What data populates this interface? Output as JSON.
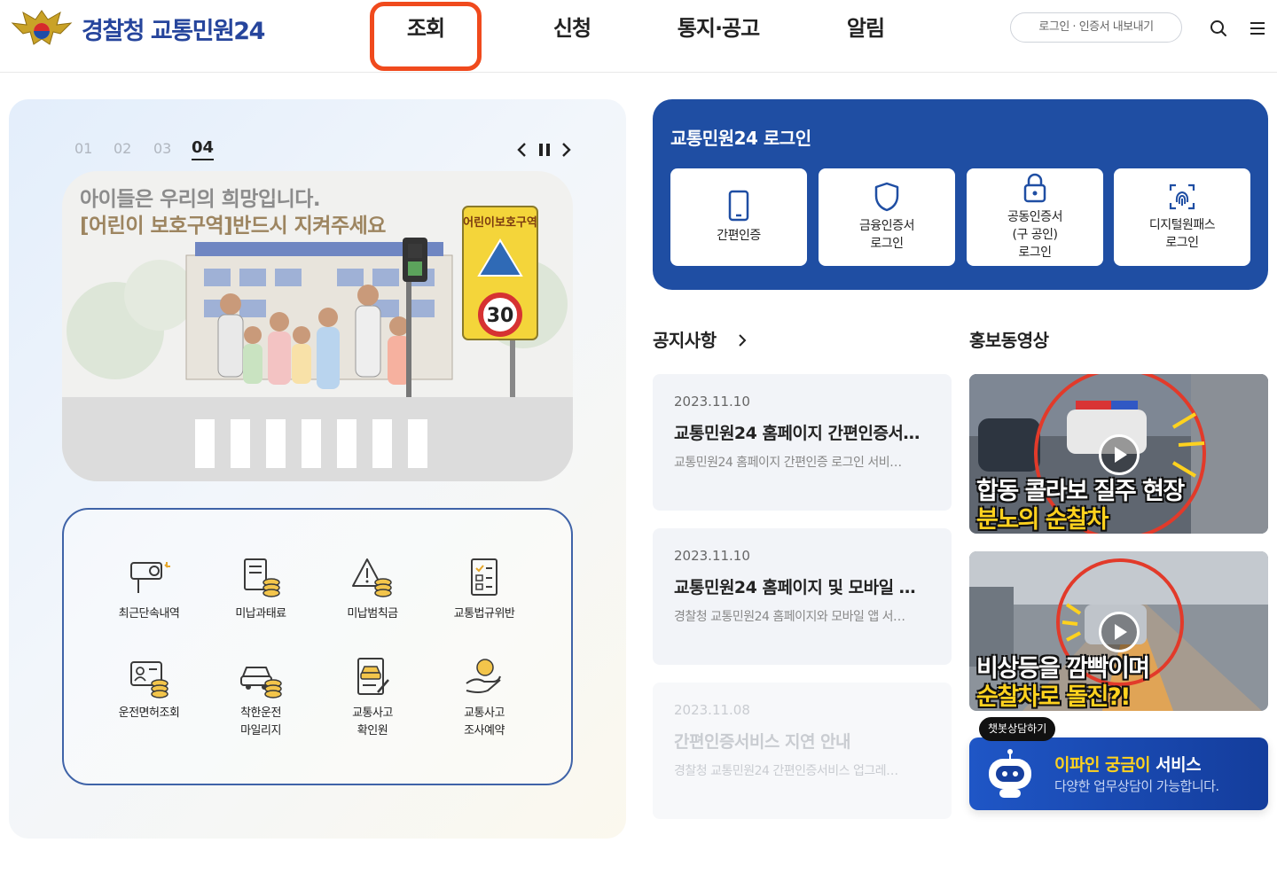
{
  "header": {
    "logo_text": "경찰청 교통민원24",
    "nav": [
      "조회",
      "신청",
      "통지·공고",
      "알림"
    ],
    "util_label": "로그인 · 인증서 내보내기",
    "colors": {
      "brand": "#26459c",
      "highlight": "#f04a1d"
    }
  },
  "slider": {
    "numbers": [
      "01",
      "02",
      "03",
      "04"
    ],
    "active": "04",
    "banner_line1": "아이들은 우리의 희망입니다.",
    "banner_line2": "[어린이 보호구역]반드시 지켜주세요",
    "sign_text": "어린이보호구역",
    "speed_limit": "30"
  },
  "quick_menu": [
    {
      "label": "최근단속내역",
      "icon": "speed-camera-icon"
    },
    {
      "label": "미납과태료",
      "icon": "unpaid-fine-icon"
    },
    {
      "label": "미납범칙금",
      "icon": "warning-coins-icon"
    },
    {
      "label": "교통법규위반",
      "icon": "checklist-icon"
    },
    {
      "label": "운전면허조회",
      "icon": "license-card-icon"
    },
    {
      "label": "착한운전\n마일리지",
      "icon": "car-coins-icon"
    },
    {
      "label": "교통사고\n확인원",
      "icon": "accident-report-icon"
    },
    {
      "label": "교통사고\n조사예약",
      "icon": "reservation-hand-icon"
    }
  ],
  "login": {
    "title": "교통민원24 로그인",
    "methods": [
      {
        "label": "간편인증",
        "icon": "phone-icon"
      },
      {
        "label": "금융인증서\n로그인",
        "icon": "shield-icon"
      },
      {
        "label": "공동인증서\n(구 공인)\n로그인",
        "icon": "lock-icon"
      },
      {
        "label": "디지털원패스\n로그인",
        "icon": "fingerprint-icon"
      }
    ],
    "color": "#1f4ea3"
  },
  "notices": {
    "title": "공지사항",
    "items": [
      {
        "date": "2023.11.10",
        "title": "교통민원24 홈페이지 간편인증서…",
        "desc": "교통민원24 홈페이지 간편인증 로그인 서비…"
      },
      {
        "date": "2023.11.10",
        "title": "교통민원24 홈페이지 및 모바일 앱…",
        "desc": "경찰청 교통민원24 홈페이지와 모바일 앱 서…"
      },
      {
        "date": "2023.11.08",
        "title": "간편인증서비스 지연 안내",
        "desc": "경찰청 교통민원24 간편인증서비스 업그레…"
      }
    ]
  },
  "videos": {
    "title": "홍보동영상",
    "items": [
      {
        "caption1": "합동 콜라보 질주 현장",
        "caption2": "분노의 순찰차"
      },
      {
        "caption1": "비상등을 깜빡이며",
        "caption2": "순찰차로 돌진?!"
      }
    ]
  },
  "chatbot": {
    "tag": "챗봇상담하기",
    "title_highlight": "이파인 궁금이",
    "title_rest": "서비스",
    "subtitle": "다양한 업무상담이 가능합니다."
  }
}
